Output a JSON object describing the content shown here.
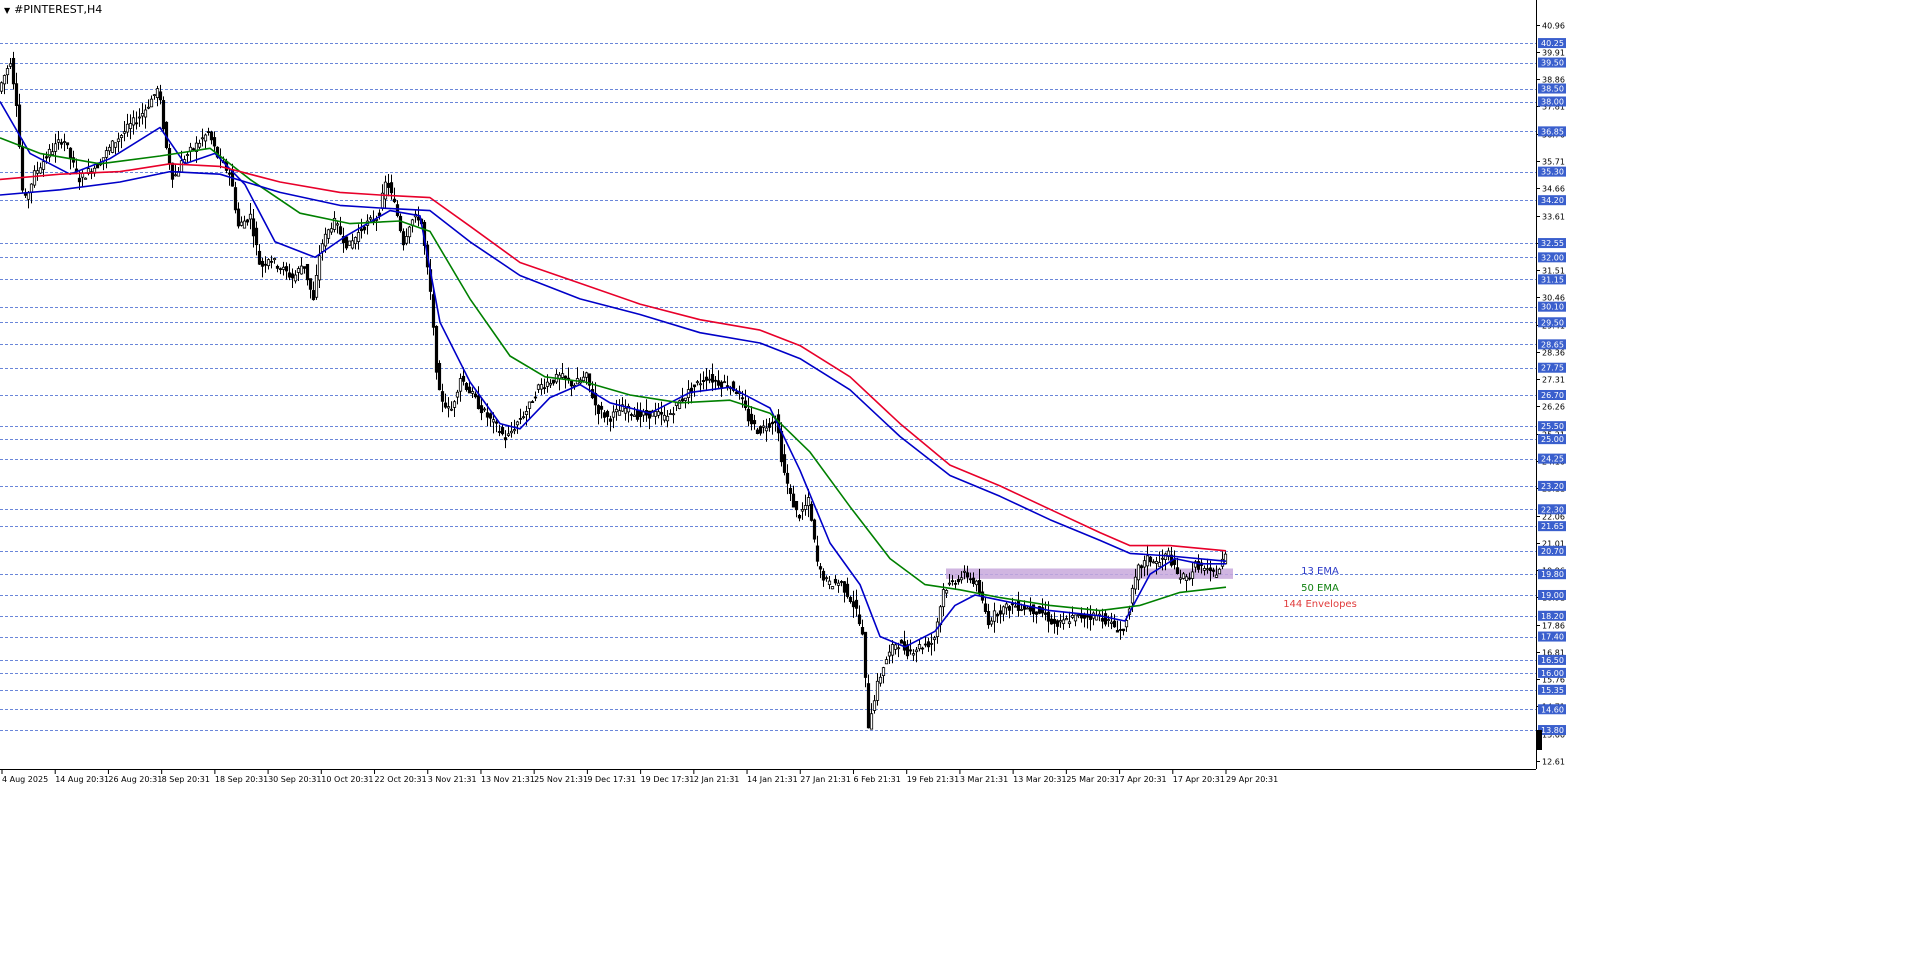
{
  "window": {
    "title": "#PINTEREST,H4",
    "menu_icon": "triangle-down-icon"
  },
  "chart_data": {
    "type": "candlestick",
    "symbol": "#PINTEREST",
    "timeframe": "H4",
    "ylim": [
      12.3,
      41.6
    ],
    "y_tick_labels": [
      40.96,
      39.91,
      38.86,
      37.81,
      36.76,
      35.71,
      34.66,
      33.61,
      32.56,
      31.51,
      30.46,
      29.41,
      28.36,
      27.31,
      26.26,
      25.21,
      24.16,
      23.11,
      22.06,
      21.01,
      19.96,
      18.91,
      17.86,
      16.81,
      15.76,
      14.71,
      13.66,
      12.61
    ],
    "x_tick_labels": [
      "4 Aug 2025",
      "14 Aug 20:31",
      "26 Aug 20:31",
      "8 Sep 20:31",
      "18 Sep 20:31",
      "30 Sep 20:31",
      "10 Oct 20:31",
      "22 Oct 20:31",
      "3 Nov 21:31",
      "13 Nov 21:31",
      "25 Nov 21:31",
      "9 Dec 17:31",
      "19 Dec 17:31",
      "2 Jan 21:31",
      "14 Jan 21:31",
      "27 Jan 21:31",
      "6 Feb 21:31",
      "19 Feb 21:31",
      "3 Mar 21:31",
      "13 Mar 20:31",
      "25 Mar 20:31",
      "7 Apr 20:31",
      "17 Apr 20:31",
      "29 Apr 20:31"
    ],
    "horizontal_levels": [
      40.25,
      39.5,
      38.5,
      38.0,
      36.85,
      35.3,
      34.2,
      32.55,
      32.0,
      31.15,
      30.1,
      29.5,
      28.65,
      27.75,
      26.7,
      25.5,
      25.0,
      24.25,
      23.2,
      22.3,
      21.65,
      20.7,
      19.8,
      19.0,
      18.2,
      17.4,
      16.5,
      16.0,
      15.35,
      14.6,
      13.8
    ],
    "current_price_marker": true,
    "price_path": [
      [
        0,
        38.4
      ],
      [
        12,
        39.6
      ],
      [
        18,
        38.0
      ],
      [
        25,
        34.0
      ],
      [
        36,
        35.2
      ],
      [
        50,
        36.0
      ],
      [
        65,
        36.6
      ],
      [
        80,
        35.0
      ],
      [
        100,
        35.6
      ],
      [
        115,
        36.4
      ],
      [
        130,
        37.0
      ],
      [
        145,
        37.6
      ],
      [
        160,
        38.5
      ],
      [
        168,
        36.2
      ],
      [
        175,
        35.0
      ],
      [
        185,
        35.8
      ],
      [
        200,
        36.4
      ],
      [
        210,
        36.8
      ],
      [
        220,
        35.8
      ],
      [
        232,
        35.2
      ],
      [
        240,
        33.2
      ],
      [
        252,
        33.6
      ],
      [
        262,
        31.6
      ],
      [
        270,
        32.0
      ],
      [
        282,
        31.6
      ],
      [
        295,
        31.2
      ],
      [
        305,
        31.8
      ],
      [
        315,
        30.3
      ],
      [
        322,
        32.4
      ],
      [
        335,
        33.4
      ],
      [
        350,
        32.4
      ],
      [
        365,
        33.2
      ],
      [
        380,
        33.6
      ],
      [
        388,
        35.0
      ],
      [
        398,
        33.8
      ],
      [
        405,
        32.6
      ],
      [
        412,
        33.4
      ],
      [
        422,
        33.6
      ],
      [
        432,
        30.6
      ],
      [
        440,
        26.8
      ],
      [
        452,
        26.0
      ],
      [
        462,
        27.4
      ],
      [
        472,
        26.8
      ],
      [
        482,
        26.2
      ],
      [
        495,
        25.6
      ],
      [
        508,
        25.0
      ],
      [
        518,
        25.6
      ],
      [
        530,
        26.2
      ],
      [
        540,
        27.0
      ],
      [
        550,
        27.2
      ],
      [
        562,
        27.4
      ],
      [
        575,
        27.1
      ],
      [
        588,
        27.4
      ],
      [
        598,
        26.2
      ],
      [
        610,
        25.8
      ],
      [
        625,
        26.2
      ],
      [
        640,
        25.9
      ],
      [
        655,
        26.0
      ],
      [
        668,
        25.8
      ],
      [
        680,
        26.4
      ],
      [
        695,
        27.0
      ],
      [
        708,
        27.4
      ],
      [
        720,
        27.2
      ],
      [
        730,
        27.1
      ],
      [
        740,
        26.8
      ],
      [
        750,
        25.8
      ],
      [
        760,
        25.3
      ],
      [
        770,
        25.6
      ],
      [
        778,
        25.8
      ],
      [
        784,
        24.0
      ],
      [
        792,
        22.8
      ],
      [
        800,
        22.0
      ],
      [
        810,
        22.6
      ],
      [
        820,
        20.0
      ],
      [
        830,
        19.4
      ],
      [
        842,
        19.5
      ],
      [
        850,
        19.0
      ],
      [
        858,
        18.4
      ],
      [
        864,
        17.4
      ],
      [
        870,
        14.0
      ],
      [
        878,
        15.4
      ],
      [
        886,
        16.4
      ],
      [
        898,
        17.2
      ],
      [
        910,
        16.8
      ],
      [
        920,
        17.0
      ],
      [
        935,
        17.2
      ],
      [
        945,
        19.2
      ],
      [
        958,
        19.6
      ],
      [
        968,
        19.8
      ],
      [
        978,
        19.4
      ],
      [
        990,
        18.0
      ],
      [
        1000,
        18.4
      ],
      [
        1015,
        18.6
      ],
      [
        1030,
        18.5
      ],
      [
        1045,
        18.3
      ],
      [
        1058,
        17.8
      ],
      [
        1072,
        18.1
      ],
      [
        1088,
        18.2
      ],
      [
        1102,
        18.2
      ],
      [
        1115,
        17.8
      ],
      [
        1125,
        17.6
      ],
      [
        1132,
        18.8
      ],
      [
        1140,
        20.0
      ],
      [
        1150,
        20.4
      ],
      [
        1160,
        20.2
      ],
      [
        1170,
        20.6
      ],
      [
        1178,
        19.8
      ],
      [
        1188,
        19.6
      ],
      [
        1198,
        20.2
      ],
      [
        1205,
        20.0
      ],
      [
        1212,
        19.8
      ],
      [
        1220,
        19.9
      ],
      [
        1226,
        20.5
      ]
    ],
    "series": [
      {
        "name": "13 EMA",
        "color": "#0000c8",
        "values": [
          [
            0,
            38.0
          ],
          [
            30,
            36.0
          ],
          [
            70,
            35.2
          ],
          [
            110,
            35.8
          ],
          [
            160,
            37.0
          ],
          [
            185,
            35.6
          ],
          [
            215,
            36.0
          ],
          [
            245,
            34.8
          ],
          [
            275,
            32.6
          ],
          [
            315,
            32.0
          ],
          [
            345,
            32.8
          ],
          [
            390,
            33.8
          ],
          [
            420,
            33.6
          ],
          [
            440,
            29.5
          ],
          [
            470,
            27.2
          ],
          [
            500,
            25.6
          ],
          [
            520,
            25.4
          ],
          [
            550,
            26.6
          ],
          [
            580,
            27.1
          ],
          [
            610,
            26.4
          ],
          [
            650,
            26.0
          ],
          [
            690,
            26.8
          ],
          [
            730,
            27.0
          ],
          [
            770,
            26.2
          ],
          [
            800,
            23.8
          ],
          [
            830,
            21.0
          ],
          [
            860,
            19.4
          ],
          [
            880,
            17.4
          ],
          [
            905,
            17.0
          ],
          [
            935,
            17.6
          ],
          [
            955,
            18.6
          ],
          [
            975,
            19.0
          ],
          [
            1000,
            18.8
          ],
          [
            1050,
            18.4
          ],
          [
            1100,
            18.2
          ],
          [
            1125,
            18.0
          ],
          [
            1150,
            19.8
          ],
          [
            1175,
            20.4
          ],
          [
            1200,
            20.2
          ],
          [
            1226,
            20.2
          ]
        ]
      },
      {
        "name": "50 EMA",
        "color": "#008000",
        "values": [
          [
            0,
            36.6
          ],
          [
            40,
            36.0
          ],
          [
            100,
            35.6
          ],
          [
            160,
            35.9
          ],
          [
            210,
            36.2
          ],
          [
            250,
            35.0
          ],
          [
            300,
            33.7
          ],
          [
            350,
            33.3
          ],
          [
            400,
            33.4
          ],
          [
            430,
            33.0
          ],
          [
            470,
            30.4
          ],
          [
            510,
            28.2
          ],
          [
            545,
            27.4
          ],
          [
            585,
            27.2
          ],
          [
            630,
            26.7
          ],
          [
            680,
            26.4
          ],
          [
            730,
            26.5
          ],
          [
            770,
            26.0
          ],
          [
            810,
            24.5
          ],
          [
            850,
            22.4
          ],
          [
            890,
            20.4
          ],
          [
            925,
            19.4
          ],
          [
            960,
            19.2
          ],
          [
            1000,
            18.9
          ],
          [
            1050,
            18.6
          ],
          [
            1100,
            18.4
          ],
          [
            1140,
            18.6
          ],
          [
            1180,
            19.1
          ],
          [
            1226,
            19.3
          ]
        ]
      },
      {
        "name": "144 Envelopes",
        "color": "#e8002a",
        "values": [
          [
            0,
            35.0
          ],
          [
            60,
            35.2
          ],
          [
            120,
            35.3
          ],
          [
            170,
            35.6
          ],
          [
            220,
            35.5
          ],
          [
            280,
            34.9
          ],
          [
            340,
            34.5
          ],
          [
            380,
            34.4
          ],
          [
            430,
            34.3
          ],
          [
            470,
            33.2
          ],
          [
            520,
            31.8
          ],
          [
            580,
            31.0
          ],
          [
            640,
            30.2
          ],
          [
            700,
            29.6
          ],
          [
            760,
            29.2
          ],
          [
            800,
            28.6
          ],
          [
            850,
            27.4
          ],
          [
            900,
            25.6
          ],
          [
            950,
            24.0
          ],
          [
            1000,
            23.2
          ],
          [
            1050,
            22.3
          ],
          [
            1100,
            21.4
          ],
          [
            1130,
            20.9
          ],
          [
            1170,
            20.9
          ],
          [
            1226,
            20.7
          ]
        ]
      },
      {
        "name": "",
        "color": "#0000c8",
        "values": [
          [
            0,
            34.4
          ],
          [
            60,
            34.6
          ],
          [
            120,
            34.9
          ],
          [
            170,
            35.3
          ],
          [
            220,
            35.2
          ],
          [
            280,
            34.5
          ],
          [
            340,
            34.0
          ],
          [
            380,
            33.9
          ],
          [
            430,
            33.8
          ],
          [
            470,
            32.6
          ],
          [
            520,
            31.3
          ],
          [
            580,
            30.4
          ],
          [
            640,
            29.8
          ],
          [
            700,
            29.1
          ],
          [
            760,
            28.7
          ],
          [
            800,
            28.1
          ],
          [
            850,
            26.9
          ],
          [
            900,
            25.1
          ],
          [
            950,
            23.6
          ],
          [
            1000,
            22.8
          ],
          [
            1050,
            21.9
          ],
          [
            1100,
            21.1
          ],
          [
            1130,
            20.6
          ],
          [
            1170,
            20.5
          ],
          [
            1226,
            20.3
          ]
        ]
      }
    ],
    "annotations": [
      {
        "text": "13 EMA",
        "color": "#2e3cc8"
      },
      {
        "text": "50 EMA",
        "color": "#108010"
      },
      {
        "text": "144 Envelopes",
        "color": "#e03c3c"
      }
    ],
    "highlight_zone": {
      "from_bar": 946,
      "to_bar": 1233,
      "y_low": 19.62,
      "y_high": 20.02,
      "color": "#c8a8dc"
    },
    "grid": false,
    "legend": "inline-right"
  }
}
